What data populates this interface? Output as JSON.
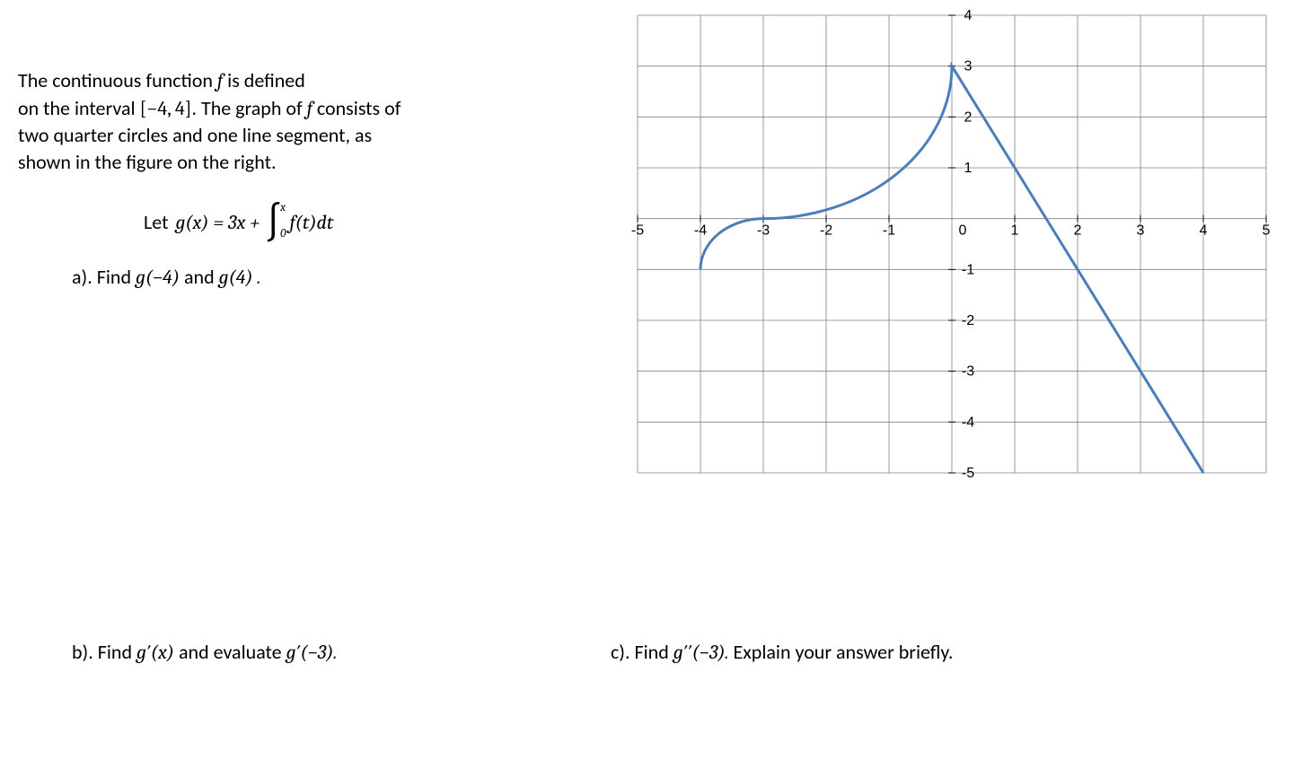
{
  "problem": {
    "line1_pre": "The continuous function ",
    "line1_f": "f",
    "line1_post": " is defined",
    "line2_pre": "on the interval ",
    "line2_interval": "[−4, 4]",
    "line2_mid": ".  The graph of ",
    "line2_f": "f",
    "line2_post": " consists of",
    "line3": "two quarter circles and one line segment, as",
    "line4": "shown in the figure on the right."
  },
  "equation": {
    "let": "Let",
    "lhs": "g(x) = 3x + ",
    "int_upper": "x",
    "int_lower": "0",
    "integrand": "f(t)dt"
  },
  "parts": {
    "a_label": "a).  Find ",
    "a_expr1": "g(−4)",
    "a_mid": "  and  ",
    "a_expr2": "g(4) .",
    "b_label": "b).  Find ",
    "b_expr1": "g′(x)",
    "b_mid": "  and  evaluate ",
    "b_expr2": "g′(−3).",
    "c_label": "c).  Find ",
    "c_expr": "g′′(−3).",
    "c_post": "  Explain your answer briefly."
  },
  "chart_data": {
    "type": "line",
    "xlim": [
      -5,
      5
    ],
    "ylim": [
      -5,
      4
    ],
    "x_ticks": [
      -5,
      -4,
      -3,
      -2,
      -1,
      0,
      1,
      2,
      3,
      4,
      5
    ],
    "y_ticks": [
      -5,
      -4,
      -3,
      -2,
      -1,
      0,
      1,
      2,
      3,
      4
    ],
    "pieces": [
      {
        "type": "quarter_circle",
        "center": [
          -4,
          0
        ],
        "radius": 1,
        "start_angle_deg": 270,
        "end_angle_deg": 360,
        "from": [
          -4,
          -1
        ],
        "to": [
          -3,
          0
        ]
      },
      {
        "type": "quarter_circle",
        "center": [
          -3,
          3
        ],
        "radius": 3,
        "start_angle_deg": 180,
        "end_angle_deg": 270,
        "from": [
          -3,
          0
        ],
        "to": [
          0,
          3
        ]
      },
      {
        "type": "line_segment",
        "from": [
          0,
          3
        ],
        "to": [
          4,
          -5
        ]
      }
    ],
    "description": "Graph of f consisting of two quarter circles and one line segment on interval [-4,4]"
  }
}
